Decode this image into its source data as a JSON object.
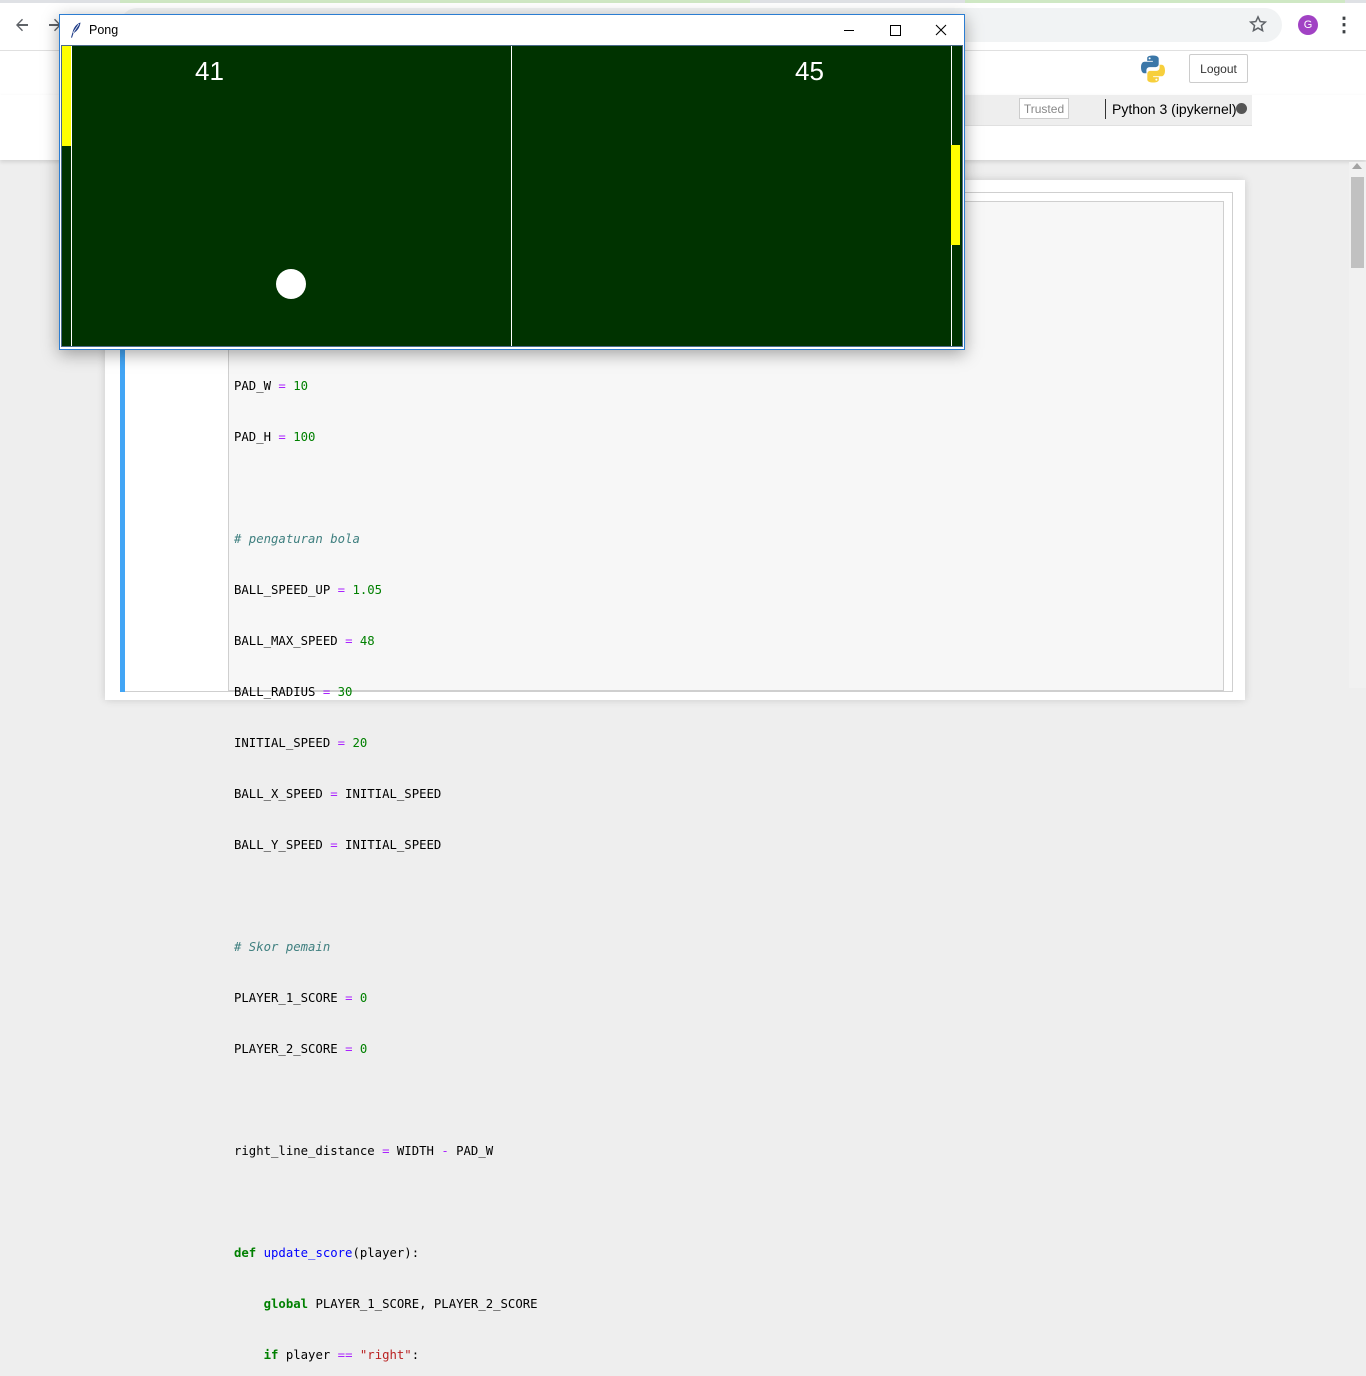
{
  "browser": {
    "back_icon": "arrow-left-icon",
    "forward_icon": "arrow-right-icon",
    "bookmark_icon": "star-icon",
    "profile_initial": "G",
    "profile_color": "#a142c4",
    "menu_icon": "kebab-menu-icon"
  },
  "jupyter": {
    "logout_label": "Logout",
    "trusted_label": "Trusted",
    "kernel_label": "Python 3 (ipykernel)",
    "cell_border_color": "#42a5f5"
  },
  "code": {
    "lines": [
      "PAD_W = 10",
      "PAD_H = 100",
      "",
      "# pengaturan bola",
      "BALL_SPEED_UP = 1.05",
      "BALL_MAX_SPEED = 48",
      "BALL_RADIUS = 30",
      "INITIAL_SPEED = 20",
      "BALL_X_SPEED = INITIAL_SPEED",
      "BALL_Y_SPEED = INITIAL_SPEED",
      "",
      "# Skor pemain",
      "PLAYER_1_SCORE = 0",
      "PLAYER_2_SCORE = 0",
      "",
      "right_line_distance = WIDTH - PAD_W",
      "",
      "def update_score(player):",
      "    global PLAYER_1_SCORE, PLAYER_2_SCORE",
      "    if player == \"right\":"
    ]
  },
  "pong": {
    "title": "Pong",
    "score_left": "41",
    "score_right": "45",
    "background_color": "#003300",
    "paddle_color": "#ffff00",
    "ball_color": "#ffffff"
  }
}
